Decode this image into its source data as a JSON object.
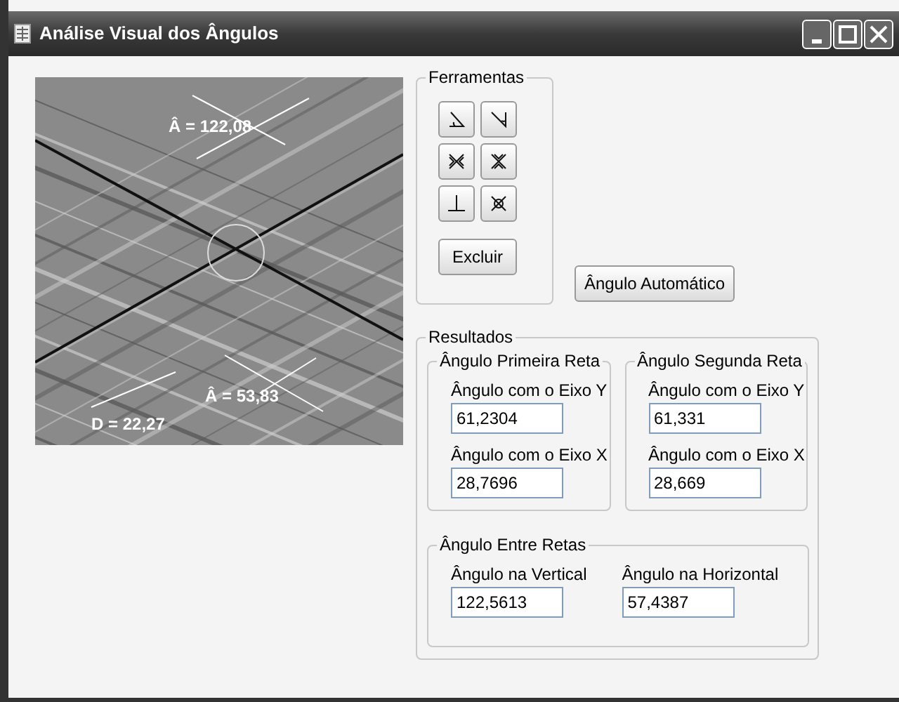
{
  "window": {
    "title": "Análise Visual dos Ângulos"
  },
  "image": {
    "annotations": [
      {
        "text": "Â = 122,08"
      },
      {
        "text": "Â = 53,83"
      },
      {
        "text": "D = 22,27"
      }
    ]
  },
  "tools": {
    "title": "Ferramentas",
    "delete_button": "Excluir"
  },
  "auto_button": "Ângulo Automático",
  "results": {
    "title": "Resultados",
    "lines": [
      {
        "title": "Ângulo Primeira Reta",
        "fields": [
          {
            "label": "Ângulo com o Eixo Y",
            "value": "61,2304"
          },
          {
            "label": "Ângulo com o Eixo X",
            "value": "28,7696"
          }
        ]
      },
      {
        "title": "Ângulo Segunda Reta",
        "fields": [
          {
            "label": "Ângulo com o Eixo Y",
            "value": "61,331"
          },
          {
            "label": "Ângulo com o Eixo X",
            "value": "28,669"
          }
        ]
      }
    ],
    "between": {
      "title": "Ângulo Entre Retas",
      "fields": [
        {
          "label": "Ângulo na Vertical",
          "value": "122,5613"
        },
        {
          "label": "Ângulo na Horizontal",
          "value": "57,4387"
        }
      ]
    }
  }
}
